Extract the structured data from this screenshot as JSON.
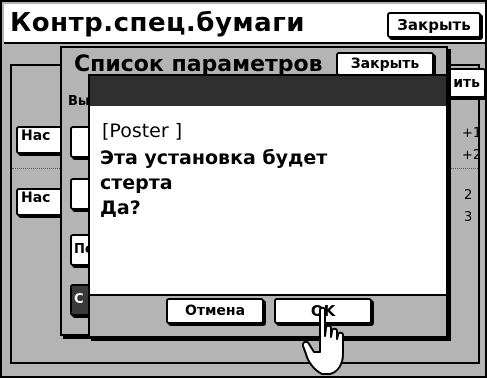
{
  "window": {
    "title": "Контр.спец.бумаги",
    "close_label": "Закрыть"
  },
  "background": {
    "tab_1": "Нас",
    "tab_2": "Нас",
    "numbers": [
      "+1",
      "+2",
      "2",
      "3"
    ]
  },
  "param_dialog": {
    "title": "Список параметров",
    "close_label": "Закрыть",
    "right_button_fragment": "ить",
    "subtitle_fragment": "Вы",
    "left_fragments": [
      "",
      "",
      "Пс",
      "С"
    ]
  },
  "confirm_dialog": {
    "item_name": "[Poster      ]",
    "message": "Эта установка будет\nстерта\nДа?",
    "cancel_label": "Отмена",
    "ok_label": "OK"
  },
  "icons": {
    "cursor": "pointing-hand-icon"
  },
  "colors": {
    "panel_gray": "#b4b4b4",
    "header_dark": "#2f2f2f",
    "white": "#ffffff",
    "black": "#000000"
  }
}
